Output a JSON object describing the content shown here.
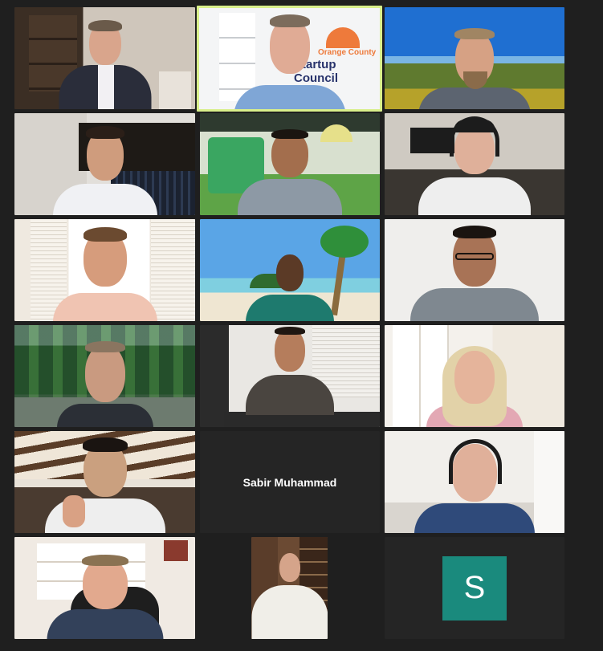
{
  "meeting": {
    "participants": [
      {
        "id": "p1",
        "type": "video"
      },
      {
        "id": "p2",
        "type": "video",
        "active_speaker": true,
        "background_text_1": "Orange County",
        "background_text_2": "Startup Council"
      },
      {
        "id": "p3",
        "type": "video"
      },
      {
        "id": "p4",
        "type": "video"
      },
      {
        "id": "p5",
        "type": "video"
      },
      {
        "id": "p6",
        "type": "video"
      },
      {
        "id": "p7",
        "type": "video"
      },
      {
        "id": "p8",
        "type": "video"
      },
      {
        "id": "p9",
        "type": "video"
      },
      {
        "id": "p10",
        "type": "video"
      },
      {
        "id": "p11",
        "type": "video"
      },
      {
        "id": "p12",
        "type": "video"
      },
      {
        "id": "p13",
        "type": "video"
      },
      {
        "id": "p14",
        "type": "name_only",
        "name": "Sabir Muhammad"
      },
      {
        "id": "p15",
        "type": "video"
      },
      {
        "id": "p16",
        "type": "video"
      },
      {
        "id": "p17",
        "type": "video"
      },
      {
        "id": "p18",
        "type": "avatar",
        "initial": "S",
        "avatar_color": "#1a8a7d"
      }
    ]
  },
  "colors": {
    "background": "#1f1f1f",
    "active_border": "#d9ef8b",
    "avatar": "#1a8a7d"
  }
}
